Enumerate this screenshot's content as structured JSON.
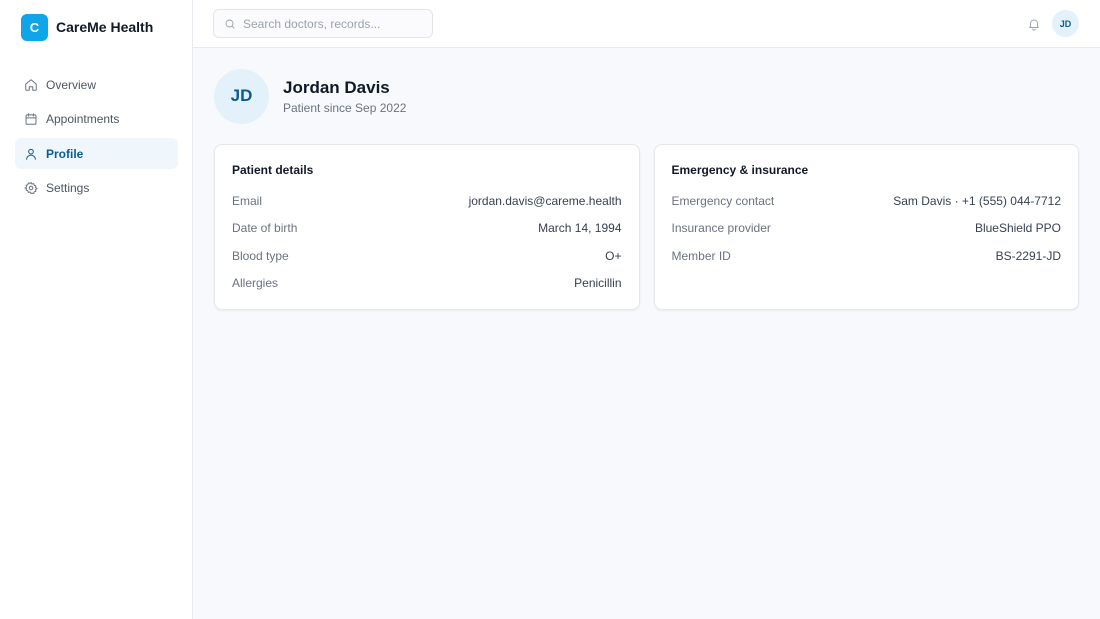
{
  "brand": {
    "logo_letter": "C",
    "name": "CareMe Health",
    "accent": "#0ea5e9"
  },
  "sidebar": {
    "items": [
      {
        "label": "Overview",
        "icon": "home-icon",
        "active": false
      },
      {
        "label": "Appointments",
        "icon": "calendar-icon",
        "active": false
      },
      {
        "label": "Profile",
        "icon": "user-icon",
        "active": true
      },
      {
        "label": "Settings",
        "icon": "gear-icon",
        "active": false
      }
    ]
  },
  "topbar": {
    "search_placeholder": "Search doctors, records...",
    "search_value": "",
    "avatar_initials": "JD"
  },
  "profile": {
    "initials": "JD",
    "name": "Jordan Davis",
    "subtitle": "Patient since Sep 2022"
  },
  "patient_details": {
    "title": "Patient details",
    "rows": [
      {
        "label": "Email",
        "value": "jordan.davis@careme.health"
      },
      {
        "label": "Date of birth",
        "value": "March 14, 1994"
      },
      {
        "label": "Blood type",
        "value": "O+"
      },
      {
        "label": "Allergies",
        "value": "Penicillin"
      }
    ]
  },
  "emergency_insurance": {
    "title": "Emergency & insurance",
    "rows": [
      {
        "label": "Emergency contact",
        "value": "Sam Davis · +1 (555) 044-7712"
      },
      {
        "label": "Insurance provider",
        "value": "BlueShield PPO"
      },
      {
        "label": "Member ID",
        "value": "BS-2291-JD"
      }
    ]
  },
  "colors": {
    "primary": "#0b5c8f",
    "active_bg": "#eff6fc",
    "avatar_bg": "#e3f1fb"
  }
}
